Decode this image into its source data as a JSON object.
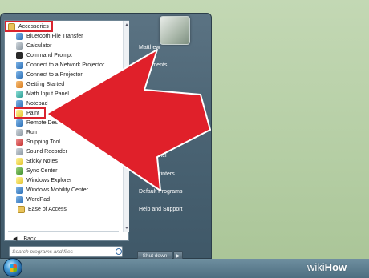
{
  "left_pane": {
    "folder_label": "Accessories",
    "items": [
      {
        "label": "Bluetooth File Transfer",
        "icon": "bluetooth-icon"
      },
      {
        "label": "Calculator",
        "icon": "calculator-icon"
      },
      {
        "label": "Command Prompt",
        "icon": "command-prompt-icon"
      },
      {
        "label": "Connect to a Network Projector",
        "icon": "network-projector-icon"
      },
      {
        "label": "Connect to a Projector",
        "icon": "projector-icon"
      },
      {
        "label": "Getting Started",
        "icon": "getting-started-icon"
      },
      {
        "label": "Math Input Panel",
        "icon": "math-input-icon"
      },
      {
        "label": "Notepad",
        "icon": "notepad-icon"
      },
      {
        "label": "Paint",
        "icon": "paint-icon"
      },
      {
        "label": "Remote Des",
        "icon": "remote-desktop-icon"
      },
      {
        "label": "Run",
        "icon": "run-icon"
      },
      {
        "label": "Snipping Tool",
        "icon": "snipping-tool-icon"
      },
      {
        "label": "Sound Recorder",
        "icon": "sound-recorder-icon"
      },
      {
        "label": "Sticky Notes",
        "icon": "sticky-notes-icon"
      },
      {
        "label": "Sync Center",
        "icon": "sync-center-icon"
      },
      {
        "label": "Windows Explorer",
        "icon": "windows-explorer-icon"
      },
      {
        "label": "Windows Mobility Center",
        "icon": "mobility-center-icon"
      },
      {
        "label": "WordPad",
        "icon": "wordpad-icon"
      },
      {
        "label": "Ease of Access",
        "icon": "folder-icon"
      }
    ],
    "back_label": "Back",
    "search_placeholder": "Search programs and files"
  },
  "right_pane": {
    "user_name": "Matthew",
    "documents": "Documents",
    "control_panel": "trol Panel",
    "devices": "D       and Printers",
    "default_programs": "Default Programs",
    "help": "Help and Support",
    "shutdown_label": "Shut down"
  },
  "watermark": {
    "part1": "wiki",
    "part2": "How"
  },
  "colors": {
    "highlight": "#d9232e",
    "arrow": "#e0202a",
    "menu": "#4a6373",
    "desktop": "#b4cda3"
  }
}
